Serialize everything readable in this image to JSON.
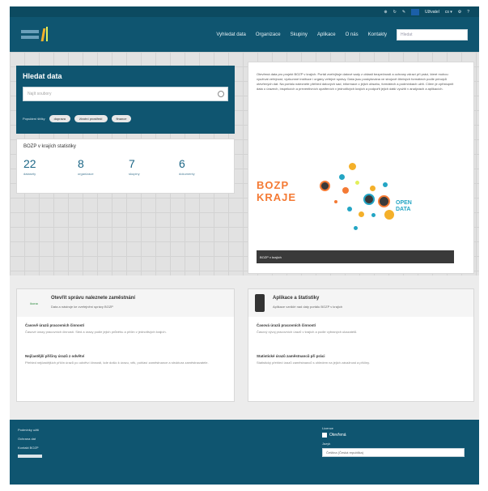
{
  "topbar": {
    "items": [
      "⊕",
      "↻",
      "✎",
      "Uživatel",
      "cs ▾",
      "⚙",
      "?"
    ]
  },
  "nav": {
    "items": [
      "Vyhledat data",
      "Organizace",
      "Skupiny",
      "Aplikace",
      "O nás",
      "Kontakty"
    ],
    "search_placeholder": "Hledat"
  },
  "find": {
    "title": "Hledat data",
    "placeholder": "Najít soubory",
    "tags_label": "Populární štítky",
    "tags": [
      "doprava",
      "životní prostředí",
      "finance"
    ]
  },
  "stats": {
    "title": "BOZP v krajích statistiky",
    "items": [
      {
        "value": "22",
        "label": "datasety"
      },
      {
        "value": "8",
        "label": "organizace"
      },
      {
        "value": "7",
        "label": "skupiny"
      },
      {
        "value": "6",
        "label": "dokumenty"
      }
    ]
  },
  "intro": {
    "text": "Otevřená data pro projekt BOZP v krajích. Portál zveřejňuje datové sady z oblasti bezpečnosti a ochrany zdraví při práci, které mohou využívat veřejnost, výzkumné instituce i orgány veřejné správy. Data jsou poskytována ve strojově čitelných formátech podle principů otevřených dat. Na portálu naleznete přehled datových sad, informace o jejich obsahu, formátech a podmínkách užití. Cílem je zpřístupnit data o úrazech, inspekcích a preventivních opatřeních v jednotlivých krajích a podpořit jejich další využití v analýzách a aplikacích.",
    "graphic": {
      "bozp": "BOZP",
      "kraje": "KRAJE",
      "open": "OPEN",
      "data": "DATA"
    },
    "caption": "BOZP v krajích"
  },
  "card_left": {
    "icon_label": "ikona",
    "title": "Otevřít správu naleznete zaměstnání",
    "subtitle": "Data a nástroje ke zveřejnění správy BOZP",
    "items": [
      {
        "title": "Časově úrazů pracovních činností",
        "text": "Časové úrazy pracovních činností. Sled a úrazy podle jejich průběhu a příčin v jednotlivých krajích."
      },
      {
        "title": "Nejčastější příčiny úrazů z odvětví",
        "text": "Přehled nejčastějších příčin úrazů po odvětví činnosti, kde došlo k úrazu, věk, pohlaví zaměstnance a struktura zaměstnavatele."
      }
    ]
  },
  "card_right": {
    "title": "Aplikace a štatistiky",
    "subtitle": "Aplikace vzniklé nad daty portálu BOZP v krajích",
    "items": [
      {
        "title": "Časová úrazů pracovních činností",
        "text": "Časový vývoj pracovních úrazů v krajích a podle vybraných ukazatelů."
      },
      {
        "title": "Statistické úrazů zaměstnanců při práci",
        "text": "Statistický přehled úrazů zaměstnanců s ohledem na jejich závažnost a příčiny."
      }
    ]
  },
  "footer": {
    "links": [
      "Podmínky užití",
      "Ochrana dat",
      "Kontakt BOZP"
    ],
    "license_heading": "Licence",
    "license_badge": "Otevřená",
    "lang_heading": "Jazyk",
    "lang_value": "Čeština (Česká republika)"
  },
  "colors": {
    "primary": "#0f5570",
    "accent_orange": "#f47a34",
    "accent_teal": "#23a5c4"
  }
}
